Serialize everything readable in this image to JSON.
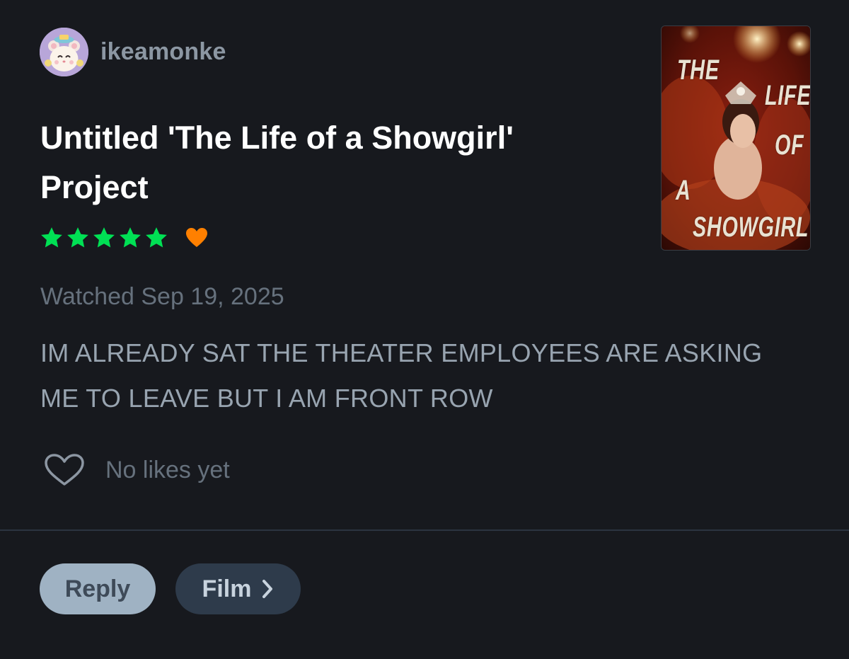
{
  "user": {
    "username": "ikeamonke",
    "avatar_icon": "hamster-avatar-icon"
  },
  "film": {
    "title": "Untitled 'The Life of a Showgirl' Project",
    "poster_title_words": [
      "THE",
      "LIFE",
      "OF",
      "A",
      "SHOWGIRL"
    ]
  },
  "rating": {
    "stars": 5,
    "max_stars": 5,
    "liked": true,
    "star_color": "#00e054",
    "heart_color": "#ff8000"
  },
  "review": {
    "watched_label": "Watched Sep 19, 2025",
    "text": "IM ALREADY SAT THE THEATER EMPLOYEES ARE ASKING ME TO LEAVE BUT I AM FRONT ROW"
  },
  "likes": {
    "label": "No likes yet",
    "icon": "heart-outline-icon"
  },
  "actions": {
    "reply_label": "Reply",
    "film_label": "Film",
    "film_icon": "chevron-right-icon"
  }
}
